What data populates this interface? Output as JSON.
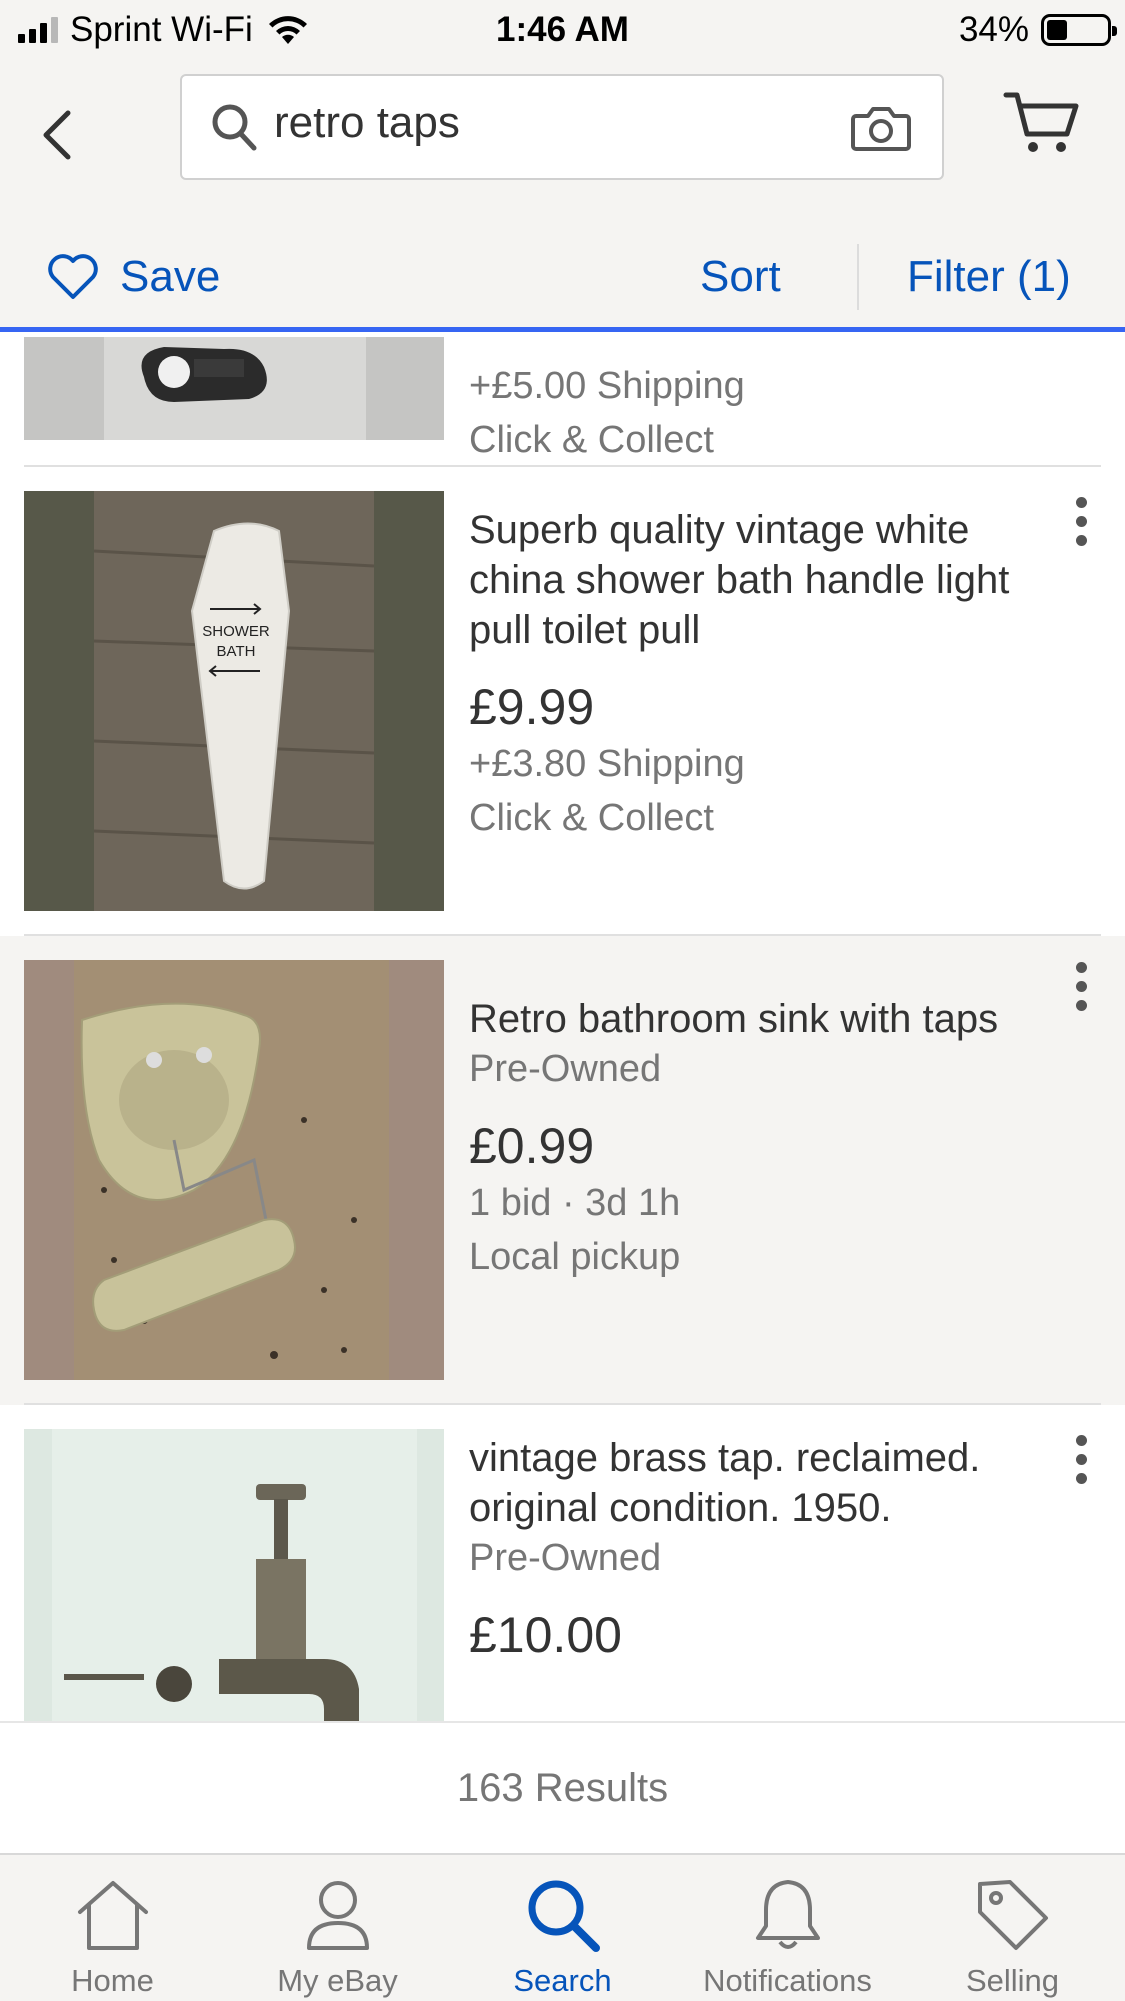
{
  "status_bar": {
    "carrier": "Sprint Wi-Fi",
    "time": "1:46 AM",
    "battery": "34%",
    "battery_level": 0.34
  },
  "header": {
    "search_query": "retro taps",
    "save_label": "Save",
    "sort_label": "Sort",
    "filter_label": "Filter (1)"
  },
  "colors": {
    "accent_blue": "#0654ba",
    "progress_blue": "#3665f3",
    "header_bg": "#f5f4f2"
  },
  "listings": [
    {
      "title": "",
      "condition": "",
      "price": "",
      "line1": "+£5.00 Shipping",
      "line2": "Click & Collect"
    },
    {
      "title": "Superb quality vintage white china shower bath handle light pull toilet pull",
      "condition": "",
      "price": "£9.99",
      "line1": "+£3.80 Shipping",
      "line2": "Click & Collect",
      "image_text": [
        "SHOWER",
        "BATH"
      ]
    },
    {
      "title": "Retro bathroom sink with taps",
      "condition": "Pre-Owned",
      "price": "£0.99",
      "line1": "1 bid · 3d 1h",
      "line2": "Local pickup"
    },
    {
      "title": "vintage brass tap. reclaimed. original condition. 1950.",
      "condition": "Pre-Owned",
      "price": "£10.00",
      "line1": "",
      "line2": ""
    }
  ],
  "results_count": "163 Results",
  "tabbar": {
    "home": "Home",
    "my_ebay": "My eBay",
    "search": "Search",
    "notifications": "Notifications",
    "selling": "Selling"
  }
}
